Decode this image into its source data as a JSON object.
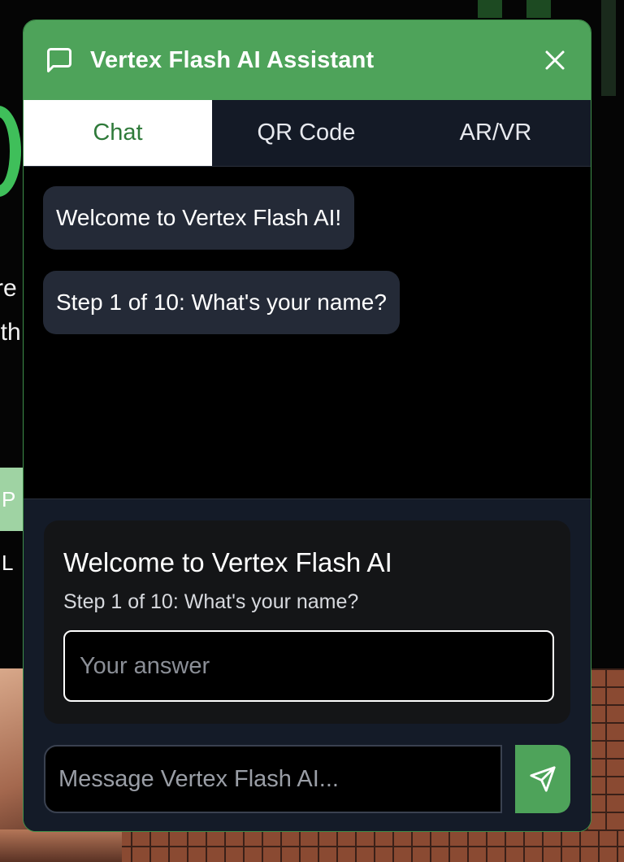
{
  "widget": {
    "title": "Vertex Flash AI Assistant",
    "accent_color": "#4ea35a",
    "icons": {
      "header": "chat-bubble-icon",
      "close": "close-icon",
      "send": "send-icon"
    }
  },
  "tabs": [
    {
      "label": "Chat",
      "active": true
    },
    {
      "label": "QR Code",
      "active": false
    },
    {
      "label": "AR/VR",
      "active": false
    }
  ],
  "messages": [
    {
      "text": "Welcome to Vertex Flash AI!"
    },
    {
      "text": "Step 1 of 10: What's your name?"
    }
  ],
  "onboarding": {
    "title": "Welcome to Vertex Flash AI",
    "step_text": "Step 1 of 10: What's your name?",
    "answer_placeholder": "Your answer",
    "answer_value": ""
  },
  "composer": {
    "placeholder": "Message Vertex Flash AI..."
  }
}
